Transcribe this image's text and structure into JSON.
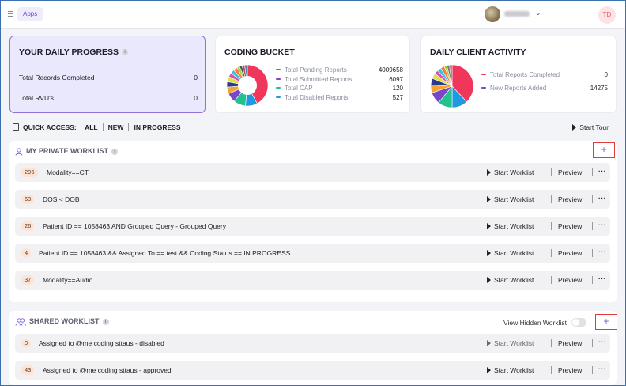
{
  "topbar": {
    "apps_label": "Apps",
    "user_avatar_icon": "user-photo-avatar",
    "user_initials": "TD"
  },
  "daily_progress": {
    "title": "YOUR DAILY PROGRESS",
    "rows": [
      {
        "label": "Total Records Completed",
        "value": "0"
      },
      {
        "label": "Total RVU's",
        "value": "0"
      }
    ]
  },
  "coding_bucket": {
    "title": "CODING BUCKET",
    "legend": [
      {
        "label": "Total Pending Reports",
        "value": "4009658",
        "color": "#f0365b"
      },
      {
        "label": "Total Submitted Reports",
        "value": "6097",
        "color": "#7b47c9"
      },
      {
        "label": "Total CAP",
        "value": "120",
        "color": "#22c28f"
      },
      {
        "label": "Total Disabled Reports",
        "value": "527",
        "color": "#1e9be0"
      }
    ]
  },
  "client_activity": {
    "title": "DAILY CLIENT ACTIVITY",
    "legend": [
      {
        "label": "Total Reports Completed",
        "value": "0",
        "color": "#f0365b"
      },
      {
        "label": "New Reports Added",
        "value": "14275",
        "color": "#7b47c9"
      }
    ]
  },
  "quick_access": {
    "label": "QUICK ACCESS:",
    "links": [
      "ALL",
      "NEW",
      "IN PROGRESS"
    ],
    "start_tour": "Start Tour"
  },
  "private_worklist": {
    "title": "MY PRIVATE WORKLIST",
    "add_label": "+",
    "rows": [
      {
        "count": "296",
        "label": "Modality==CT",
        "start": "Start Worklist",
        "preview": "Preview",
        "more": "···"
      },
      {
        "count": "63",
        "label": "DOS < DOB",
        "start": "Start Worklist",
        "preview": "Preview",
        "more": "···"
      },
      {
        "count": "26",
        "label": "Patient ID == 1058463 AND Grouped Query - Grouped Query",
        "start": "Start Worklist",
        "preview": "Preview",
        "more": "···"
      },
      {
        "count": "4",
        "label": "Patient ID == 1058463 && Assigned To == test && Coding Status == IN PROGRESS",
        "start": "Start Worklist",
        "preview": "Preview",
        "more": "···"
      },
      {
        "count": "37",
        "label": "Modality==Audio",
        "start": "Start Worklist",
        "preview": "Preview",
        "more": "···"
      }
    ]
  },
  "shared_worklist": {
    "title": "SHARED WORKLIST",
    "view_hidden_label": "View Hidden Worklist",
    "view_hidden_on": false,
    "add_label": "+",
    "rows": [
      {
        "count": "0",
        "label": "Assigned to @me coding sttaus - disabled",
        "start": "Start Worklist",
        "preview": "Preview",
        "more": "···",
        "disabled": true
      },
      {
        "count": "43",
        "label": "Assigned to @me coding sttaus - approved",
        "start": "Start Worklist",
        "preview": "Preview",
        "more": "···",
        "disabled": false
      }
    ]
  }
}
